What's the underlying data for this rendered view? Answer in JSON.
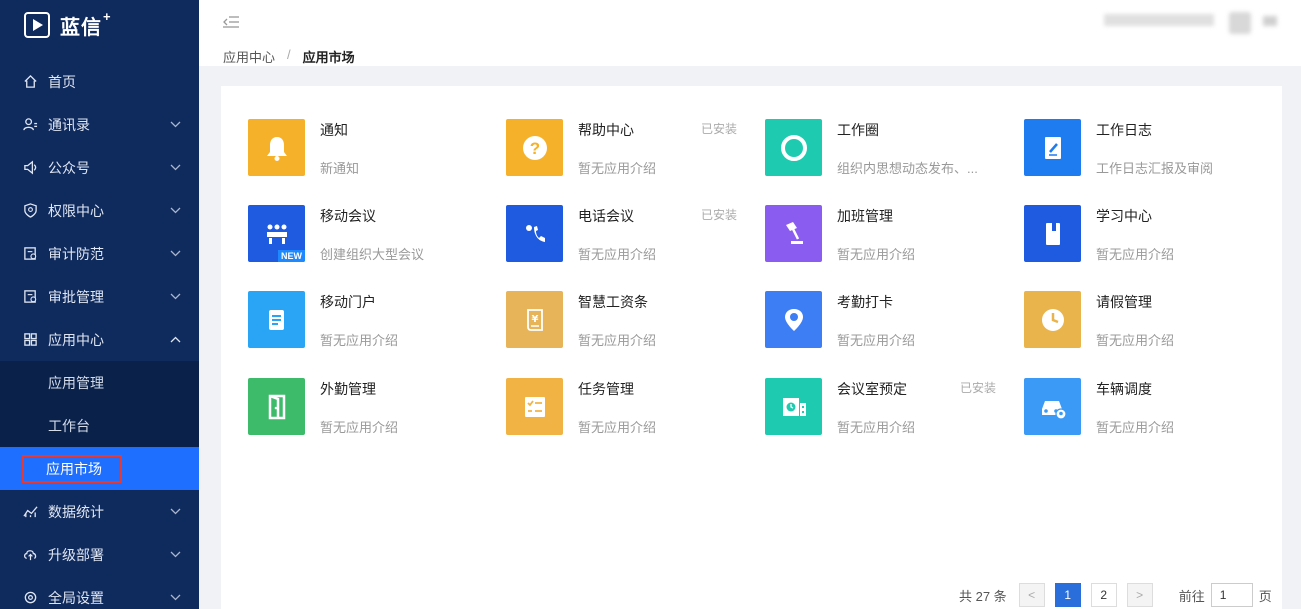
{
  "brand": {
    "name": "蓝信",
    "plus": "+"
  },
  "sidebar": {
    "items": [
      {
        "label": "首页",
        "icon": "home-icon",
        "has_children": false
      },
      {
        "label": "通讯录",
        "icon": "contacts-icon",
        "has_children": true
      },
      {
        "label": "公众号",
        "icon": "speaker-icon",
        "has_children": true
      },
      {
        "label": "权限中心",
        "icon": "shield-icon",
        "has_children": true
      },
      {
        "label": "审计防范",
        "icon": "audit-icon",
        "has_children": true
      },
      {
        "label": "审批管理",
        "icon": "approval-icon",
        "has_children": true
      },
      {
        "label": "应用中心",
        "icon": "grid-icon",
        "has_children": true,
        "expanded": true
      },
      {
        "label": "数据统计",
        "icon": "chart-icon",
        "has_children": true
      },
      {
        "label": "升级部署",
        "icon": "upload-icon",
        "has_children": true
      },
      {
        "label": "全局设置",
        "icon": "settings-icon",
        "has_children": true
      }
    ],
    "app_center_children": [
      {
        "label": "应用管理"
      },
      {
        "label": "工作台"
      },
      {
        "label": "应用市场",
        "active": true
      }
    ]
  },
  "header": {
    "breadcrumb": [
      "应用中心",
      "应用市场"
    ],
    "separator": "/"
  },
  "apps": [
    {
      "name": "通知",
      "desc": "新通知",
      "badge": "",
      "color": "#f6b12a",
      "icon": "bell-icon"
    },
    {
      "name": "帮助中心",
      "desc": "暂无应用介绍",
      "badge": "已安装",
      "color": "#f6b12a",
      "icon": "question-icon"
    },
    {
      "name": "工作圈",
      "desc": "组织内思想动态发布、...",
      "badge": "",
      "color": "#1fcbb0",
      "icon": "circle-icon"
    },
    {
      "name": "工作日志",
      "desc": "工作日志汇报及审阅",
      "badge": "",
      "color": "#1e7cf0",
      "icon": "journal-icon"
    },
    {
      "name": "移动会议",
      "desc": "创建组织大型会议",
      "badge": "",
      "color": "#1e5be0",
      "icon": "meeting-icon",
      "tag": "NEW"
    },
    {
      "name": "电话会议",
      "desc": "暂无应用介绍",
      "badge": "已安装",
      "color": "#1e5be0",
      "icon": "phone-icon"
    },
    {
      "name": "加班管理",
      "desc": "暂无应用介绍",
      "badge": "",
      "color": "#8a5cf0",
      "icon": "lamp-icon"
    },
    {
      "name": "学习中心",
      "desc": "暂无应用介绍",
      "badge": "",
      "color": "#1e5be0",
      "icon": "book-icon"
    },
    {
      "name": "移动门户",
      "desc": "暂无应用介绍",
      "badge": "",
      "color": "#2aa5f5",
      "icon": "portal-icon"
    },
    {
      "name": "智慧工资条",
      "desc": "暂无应用介绍",
      "badge": "",
      "color": "#e7b45a",
      "icon": "payslip-icon"
    },
    {
      "name": "考勤打卡",
      "desc": "暂无应用介绍",
      "badge": "",
      "color": "#3d7ef5",
      "icon": "location-icon"
    },
    {
      "name": "请假管理",
      "desc": "暂无应用介绍",
      "badge": "",
      "color": "#e9b44c",
      "icon": "clock-icon"
    },
    {
      "name": "外勤管理",
      "desc": "暂无应用介绍",
      "badge": "",
      "color": "#3dbb6a",
      "icon": "door-icon"
    },
    {
      "name": "任务管理",
      "desc": "暂无应用介绍",
      "badge": "",
      "color": "#f2b345",
      "icon": "checklist-icon"
    },
    {
      "name": "会议室预定",
      "desc": "暂无应用介绍",
      "badge": "已安装",
      "color": "#1fcbb0",
      "icon": "room-icon"
    },
    {
      "name": "车辆调度",
      "desc": "暂无应用介绍",
      "badge": "",
      "color": "#3a9af5",
      "icon": "car-icon"
    }
  ],
  "pagination": {
    "total_text": "共 27 条",
    "prev": "<",
    "next": ">",
    "pages": [
      "1",
      "2"
    ],
    "current": "1",
    "goto_label": "前往",
    "goto_value": "1",
    "page_suffix": "页"
  }
}
